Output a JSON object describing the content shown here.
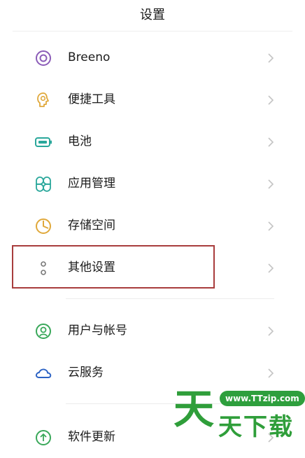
{
  "header": {
    "title": "设置"
  },
  "items": [
    {
      "label": "Breeno",
      "icon": "breeno-icon"
    },
    {
      "label": "便捷工具",
      "icon": "convenience-tools-icon"
    },
    {
      "label": "电池",
      "icon": "battery-icon"
    },
    {
      "label": "应用管理",
      "icon": "app-management-icon"
    },
    {
      "label": "存储空间",
      "icon": "storage-icon"
    },
    {
      "label": "其他设置",
      "icon": "other-settings-icon"
    },
    {
      "label": "用户与帐号",
      "icon": "user-account-icon"
    },
    {
      "label": "云服务",
      "icon": "cloud-icon"
    },
    {
      "label": "软件更新",
      "icon": "software-update-icon"
    }
  ],
  "watermark": {
    "url": "www.TTzip.com",
    "text": "天下载",
    "logo": "天"
  },
  "colors": {
    "highlight": "#a83c3c",
    "watermark_green": "#2f9e3a"
  }
}
